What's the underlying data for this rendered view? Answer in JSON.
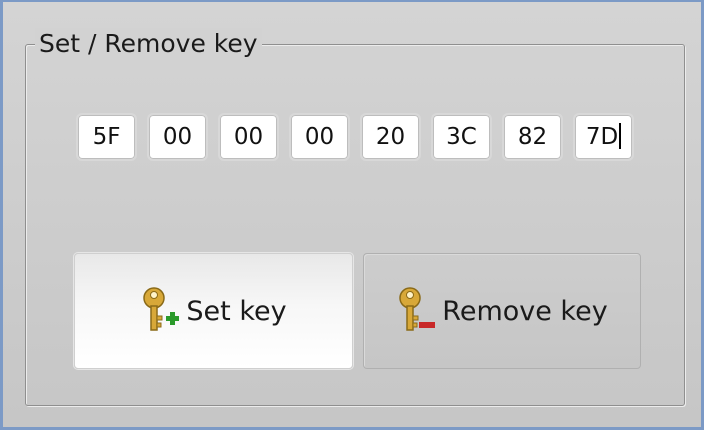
{
  "groupbox": {
    "title": "Set / Remove key"
  },
  "key_fields": [
    {
      "value": "5F"
    },
    {
      "value": "00"
    },
    {
      "value": "00"
    },
    {
      "value": "00"
    },
    {
      "value": "20"
    },
    {
      "value": "3C"
    },
    {
      "value": "82"
    },
    {
      "value": "7D"
    }
  ],
  "buttons": {
    "set_key": {
      "label": "Set key",
      "icon": "key-add-icon"
    },
    "remove_key": {
      "label": "Remove key",
      "icon": "key-remove-icon"
    }
  },
  "colors": {
    "window_border": "#7c9ac6",
    "key_gold": "#d8a838",
    "add_green": "#2a9a2a",
    "remove_red": "#c82828"
  }
}
